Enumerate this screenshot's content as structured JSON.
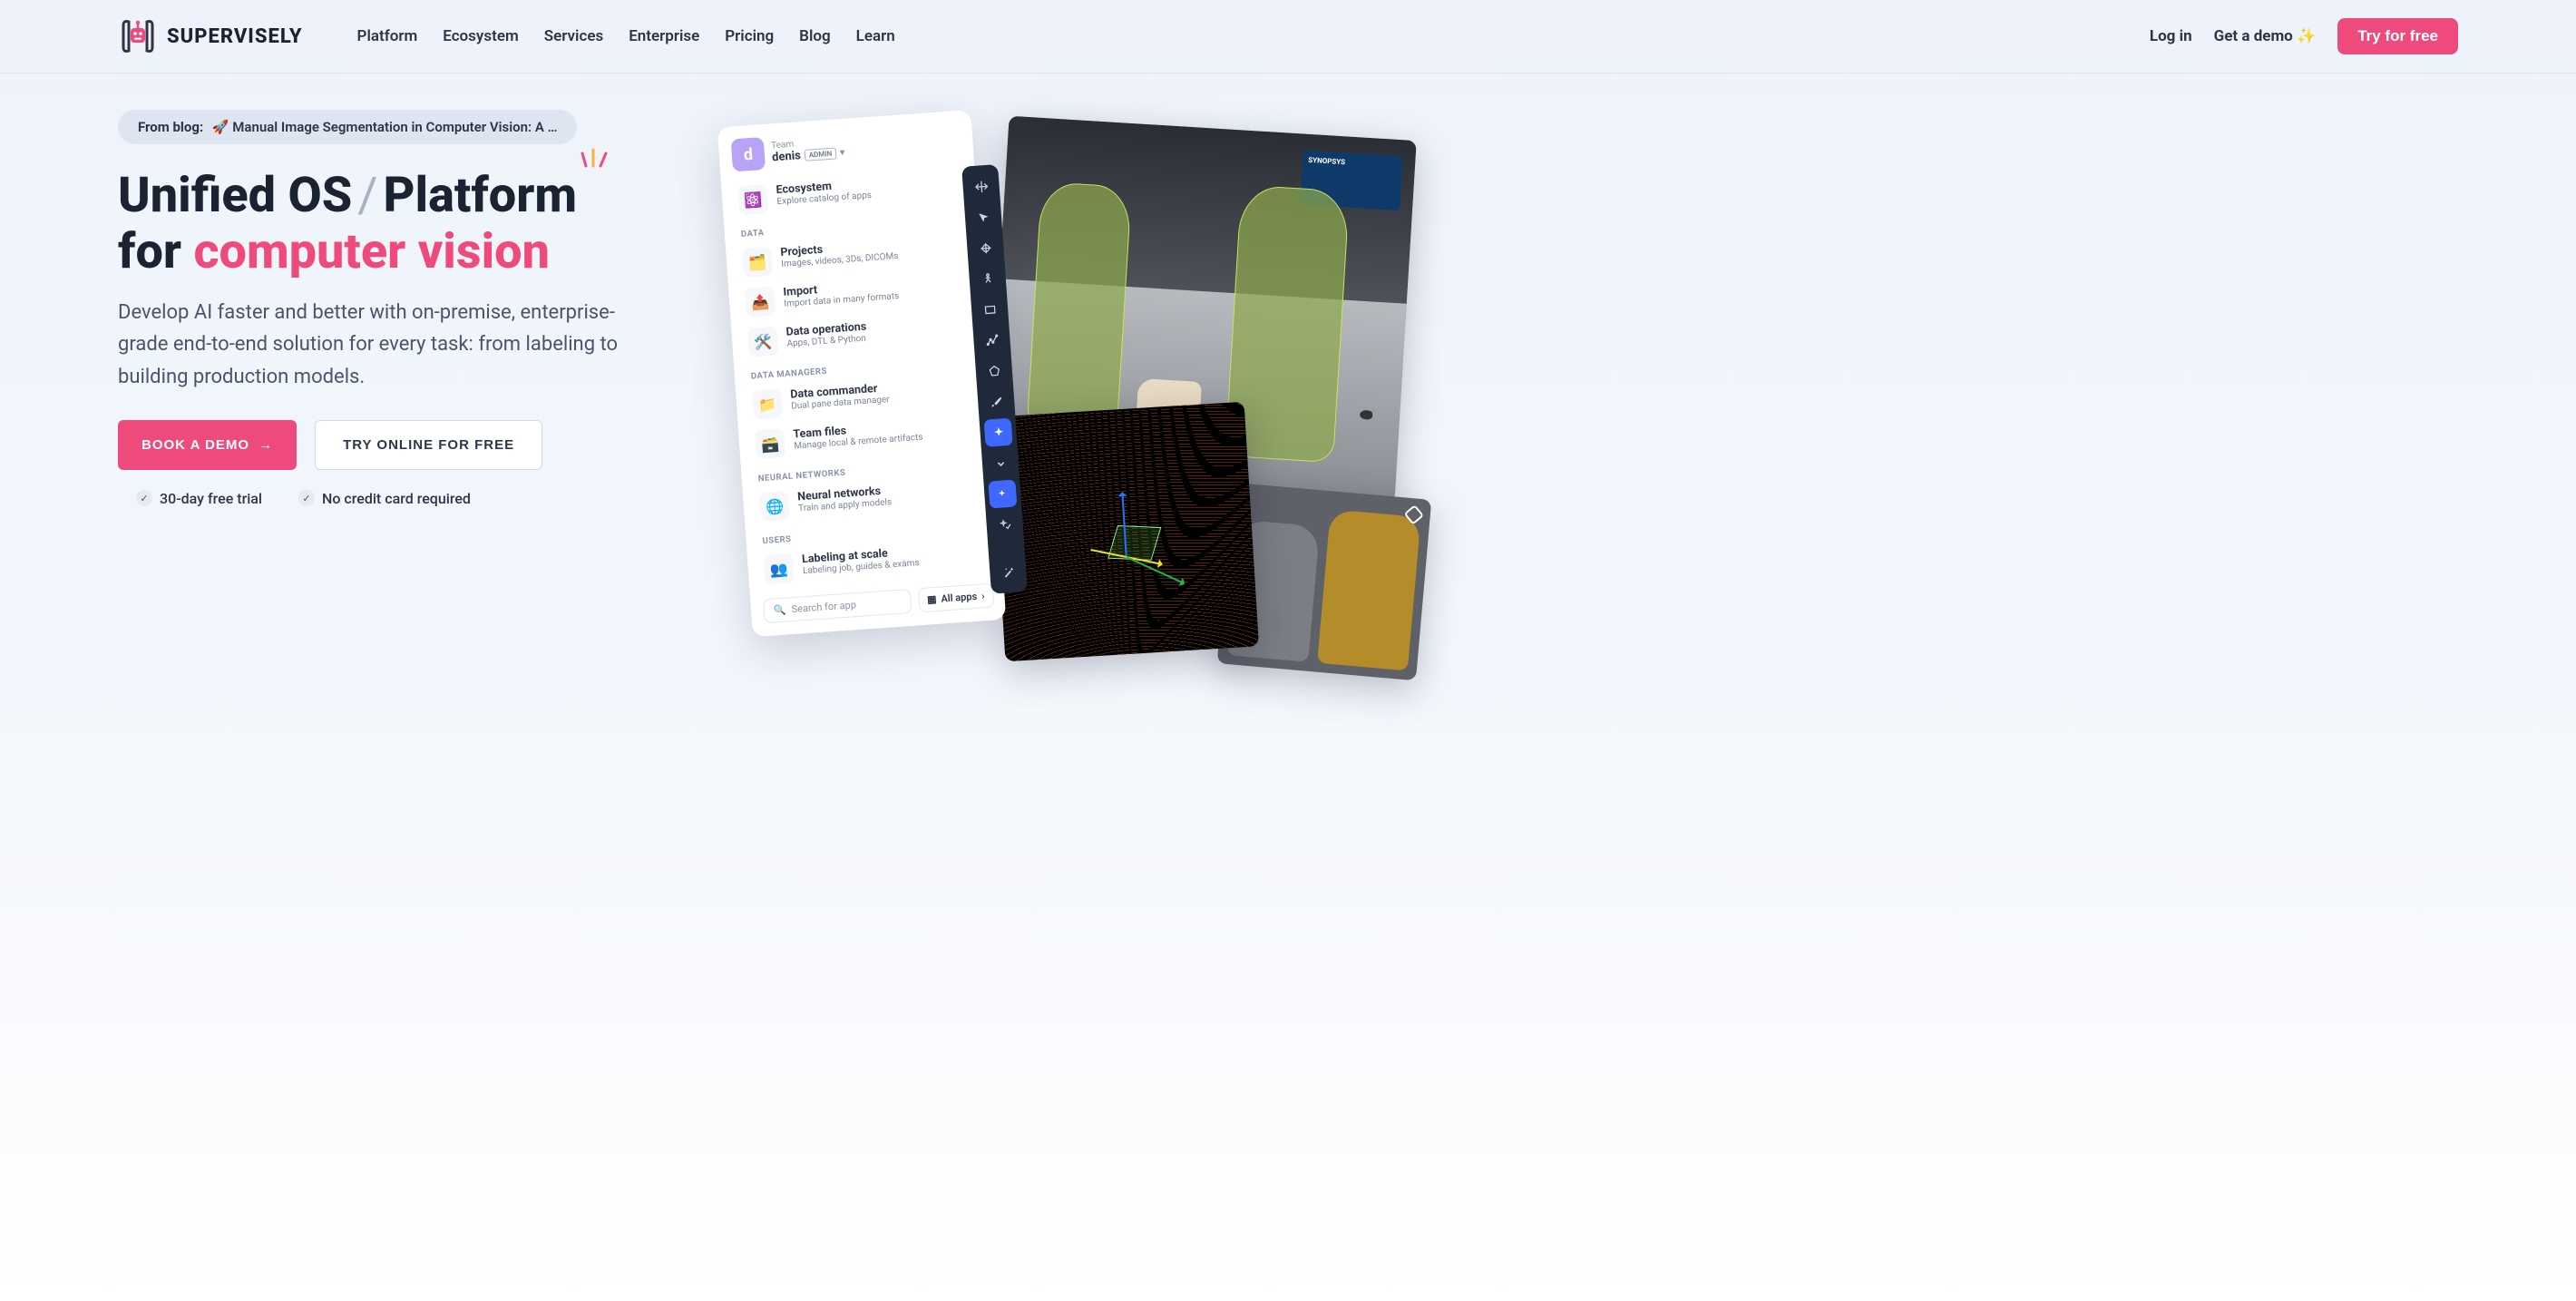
{
  "header": {
    "brand": "SUPERVISELY",
    "nav": [
      "Platform",
      "Ecosystem",
      "Services",
      "Enterprise",
      "Pricing",
      "Blog",
      "Learn"
    ],
    "login": "Log in",
    "get_demo": "Get a demo ✨",
    "try_free": "Try for free"
  },
  "hero": {
    "blog_prefix": "From blog:",
    "blog_text": "🚀  Manual Image Segmentation in Computer Vision: A …",
    "title_line1a": "Unified OS",
    "title_line1b": "Platform",
    "title_line2a": "for ",
    "title_line2b": "computer vision",
    "subtitle": "Develop AI faster and better with on-premise, enterprise-grade end-to-end solution for every task: from labeling to building production models.",
    "btn_demo": "BOOK A DEMO",
    "btn_try": "TRY ONLINE FOR FREE",
    "check1": "30-day free trial",
    "check2": "No credit card required"
  },
  "panel": {
    "avatar_letter": "d",
    "team_label": "Team",
    "user_name": "denis",
    "admin_badge": "ADMIN",
    "ecosystem": {
      "title": "Ecosystem",
      "sub": "Explore catalog of apps"
    },
    "section_data": "DATA",
    "projects": {
      "title": "Projects",
      "sub": "Images, videos, 3Ds, DICOMs"
    },
    "import": {
      "title": "Import",
      "sub": "Import data in many formats"
    },
    "data_ops": {
      "title": "Data operations",
      "sub": "Apps, DTL & Python"
    },
    "section_managers": "DATA MANAGERS",
    "commander": {
      "title": "Data commander",
      "sub": "Dual pane data manager"
    },
    "team_files": {
      "title": "Team files",
      "sub": "Manage local & remote artifacts"
    },
    "section_nn": "NEURAL NETWORKS",
    "nn": {
      "title": "Neural networks",
      "sub": "Train and apply models"
    },
    "section_users": "USERS",
    "labeling": {
      "title": "Labeling at scale",
      "sub": "Labeling job, guides & exams"
    },
    "search_placeholder": "Search for app",
    "all_apps": "All apps"
  },
  "banner_text": "SYNOPSYS"
}
